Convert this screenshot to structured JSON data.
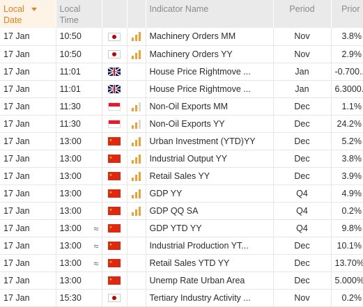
{
  "header": {
    "date_label_1": "Local",
    "date_label_2": "Date",
    "time_label_1": "Local",
    "time_label_2": "Time",
    "name_label": "Indicator Name",
    "period_label": "Period",
    "prior_label": "Prior"
  },
  "colors": {
    "accent": "#e8811c",
    "header_bg": "#eaeaea",
    "sorted_bg": "#fdf3e6",
    "impact_bar": "#f0a030"
  },
  "rows": [
    {
      "date": "17 Jan",
      "time": "10:50",
      "approx": "",
      "country": "jp",
      "impact": 3,
      "name": "Machinery Orders MM",
      "period": "Nov",
      "prior": "3.8%"
    },
    {
      "date": "17 Jan",
      "time": "10:50",
      "approx": "",
      "country": "jp",
      "impact": 3,
      "name": "Machinery Orders YY",
      "period": "Nov",
      "prior": "2.9%"
    },
    {
      "date": "17 Jan",
      "time": "11:01",
      "approx": "",
      "country": "uk",
      "impact": 0,
      "name": "House Price Rightmove ...",
      "period": "Jan",
      "prior": "-0.700..."
    },
    {
      "date": "17 Jan",
      "time": "11:01",
      "approx": "",
      "country": "uk",
      "impact": 0,
      "name": "House Price Rightmove ...",
      "period": "Jan",
      "prior": "6.3000..."
    },
    {
      "date": "17 Jan",
      "time": "11:30",
      "approx": "",
      "country": "sg",
      "impact": 2,
      "name": "Non-Oil Exports MM",
      "period": "Dec",
      "prior": "1.1%"
    },
    {
      "date": "17 Jan",
      "time": "11:30",
      "approx": "",
      "country": "sg",
      "impact": 2,
      "name": "Non-Oil Exports YY",
      "period": "Dec",
      "prior": "24.2%"
    },
    {
      "date": "17 Jan",
      "time": "13:00",
      "approx": "",
      "country": "cn",
      "impact": 3,
      "name": "Urban Investment (YTD)YY",
      "period": "Dec",
      "prior": "5.2%"
    },
    {
      "date": "17 Jan",
      "time": "13:00",
      "approx": "",
      "country": "cn",
      "impact": 3,
      "name": "Industrial Output YY",
      "period": "Dec",
      "prior": "3.8%"
    },
    {
      "date": "17 Jan",
      "time": "13:00",
      "approx": "",
      "country": "cn",
      "impact": 3,
      "name": "Retail Sales YY",
      "period": "Dec",
      "prior": "3.9%"
    },
    {
      "date": "17 Jan",
      "time": "13:00",
      "approx": "",
      "country": "cn",
      "impact": 3,
      "name": "GDP YY",
      "period": "Q4",
      "prior": "4.9%"
    },
    {
      "date": "17 Jan",
      "time": "13:00",
      "approx": "",
      "country": "cn",
      "impact": 3,
      "name": "GDP QQ SA",
      "period": "Q4",
      "prior": "0.2%"
    },
    {
      "date": "17 Jan",
      "time": "13:00",
      "approx": "≈",
      "country": "cn",
      "impact": 0,
      "name": "GDP YTD YY",
      "period": "Q4",
      "prior": "9.8%"
    },
    {
      "date": "17 Jan",
      "time": "13:00",
      "approx": "≈",
      "country": "cn",
      "impact": 0,
      "name": "Industrial Production YT...",
      "period": "Dec",
      "prior": "10.1%"
    },
    {
      "date": "17 Jan",
      "time": "13:00",
      "approx": "≈",
      "country": "cn",
      "impact": 0,
      "name": "Retail Sales YTD YY",
      "period": "Dec",
      "prior": "13.70%"
    },
    {
      "date": "17 Jan",
      "time": "13:00",
      "approx": "",
      "country": "cn",
      "impact": 0,
      "name": "Unemp Rate Urban Area",
      "period": "Dec",
      "prior": "5.000%"
    },
    {
      "date": "17 Jan",
      "time": "15:30",
      "approx": "",
      "country": "jp",
      "impact": 0,
      "name": "Tertiary Industry Activity ...",
      "period": "Nov",
      "prior": "0.2%"
    }
  ]
}
